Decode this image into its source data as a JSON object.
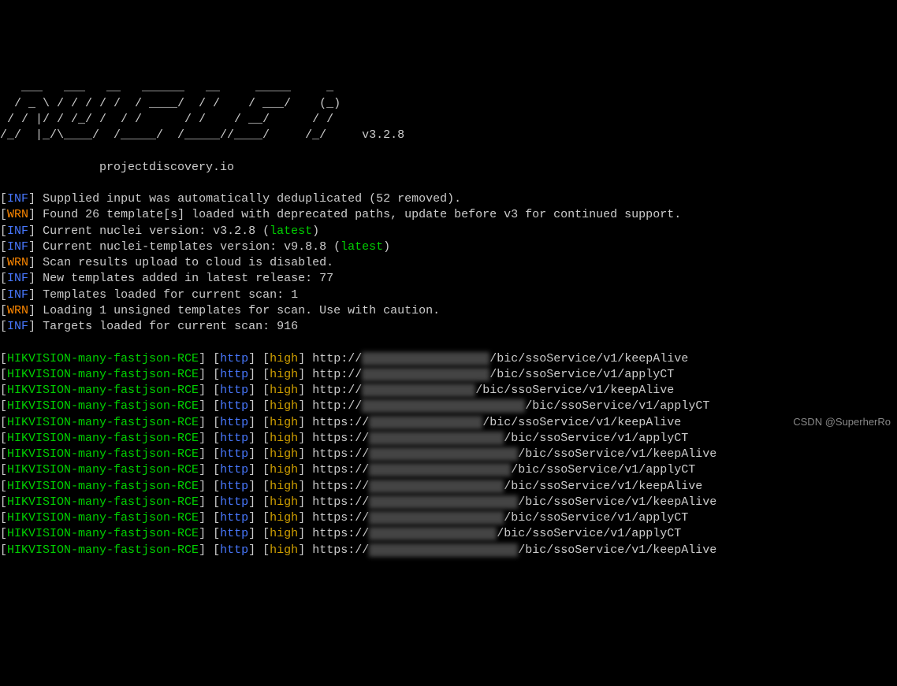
{
  "ascii_art": "         ___                __    _  \n   ____ /  /__ ___ __ _____/ /   (_)\n  / __ \\/ / / / ___/ / /_  / /  / / \n / / / / /_/ / /__/ /  __/ / /__/ /  \n/_/ /_/\\__,_/\\___/_/\\___/_/\\___/_/",
  "version": "v3.2.8",
  "subtitle": "projectdiscovery.io",
  "log_lines": [
    {
      "tag": "INF",
      "text": "Supplied input was automatically deduplicated (52 removed)."
    },
    {
      "tag": "WRN",
      "text": "Found 26 template[s] loaded with deprecated paths, update before v3 for continued support."
    },
    {
      "tag": "INF",
      "text": "Current nuclei version: v3.2.8 (",
      "suffix_green": "latest",
      "suffix_end": ")"
    },
    {
      "tag": "INF",
      "text": "Current nuclei-templates version: v9.8.8 (",
      "suffix_green": "latest",
      "suffix_end": ")"
    },
    {
      "tag": "WRN",
      "text": "Scan results upload to cloud is disabled."
    },
    {
      "tag": "INF",
      "text": "New templates added in latest release: 77"
    },
    {
      "tag": "INF",
      "text": "Templates loaded for current scan: 1"
    },
    {
      "tag": "WRN",
      "text": "Loading 1 unsigned templates for scan. Use with caution."
    },
    {
      "tag": "INF",
      "text": "Targets loaded for current scan: 916"
    }
  ],
  "results": [
    {
      "template": "HIKVISION-many-fastjson-RCE",
      "proto": "http",
      "severity": "high",
      "url_prefix": "http://",
      "url_redacted": "2xx.xxx.xxx.xxx:85",
      "url_suffix": "/bic/ssoService/v1/keepAlive"
    },
    {
      "template": "HIKVISION-many-fastjson-RCE",
      "proto": "http",
      "severity": "high",
      "url_prefix": "http://",
      "url_redacted": "1xx.xxx.xxx.xxx.xx",
      "url_suffix": "/bic/ssoService/v1/applyCT"
    },
    {
      "template": "HIKVISION-many-fastjson-RCE",
      "proto": "http",
      "severity": "high",
      "url_prefix": "http://",
      "url_redacted": "2xx.xxx.xx.xxxxx",
      "url_suffix": "/bic/ssoService/v1/keepAlive"
    },
    {
      "template": "HIKVISION-many-fastjson-RCE",
      "proto": "http",
      "severity": "high",
      "url_prefix": "http://",
      "url_redacted": "xxxxxxxxxxxxxxxxxxxxxxx",
      "url_suffix": "/bic/ssoService/v1/applyCT"
    },
    {
      "template": "HIKVISION-many-fastjson-RCE",
      "proto": "http",
      "severity": "high",
      "url_prefix": "https://",
      "url_redacted": "1xxxxxxxxxxxxxxx",
      "url_suffix": "/bic/ssoService/v1/keepAlive"
    },
    {
      "template": "HIKVISION-many-fastjson-RCE",
      "proto": "http",
      "severity": "high",
      "url_prefix": "https://",
      "url_redacted": "1xxxxxxxxxxxxxxxxxx",
      "url_suffix": "/bic/ssoService/v1/applyCT"
    },
    {
      "template": "HIKVISION-many-fastjson-RCE",
      "proto": "http",
      "severity": "high",
      "url_prefix": "https://",
      "url_redacted": "1xxxxxxxxxxxxxxxxxxxx",
      "url_suffix": "/bic/ssoService/v1/keepAlive"
    },
    {
      "template": "HIKVISION-many-fastjson-RCE",
      "proto": "http",
      "severity": "high",
      "url_prefix": "https://",
      "url_redacted": "1xx.xxx.xxx.xxx:xxxx",
      "url_suffix": "/bic/ssoService/v1/applyCT"
    },
    {
      "template": "HIKVISION-many-fastjson-RCE",
      "proto": "http",
      "severity": "high",
      "url_prefix": "https://",
      "url_redacted": "1xxxxxxxxxxxxxxxxxx",
      "url_suffix": "/bic/ssoService/v1/keepAlive"
    },
    {
      "template": "HIKVISION-many-fastjson-RCE",
      "proto": "http",
      "severity": "high",
      "url_prefix": "https://",
      "url_redacted": "xxxxxxxxxxxxxxxxxxxxx",
      "url_suffix": "/bic/ssoService/v1/keepAlive"
    },
    {
      "template": "HIKVISION-many-fastjson-RCE",
      "proto": "http",
      "severity": "high",
      "url_prefix": "https://",
      "url_redacted": "xxxxxxxxxxxxxxxxxxx",
      "url_suffix": "/bic/ssoService/v1/applyCT"
    },
    {
      "template": "HIKVISION-many-fastjson-RCE",
      "proto": "http",
      "severity": "high",
      "url_prefix": "https://",
      "url_redacted": "1xx.xxx.xxxxxxxxxx",
      "url_suffix": "/bic/ssoService/v1/applyCT"
    },
    {
      "template": "HIKVISION-many-fastjson-RCE",
      "proto": "http",
      "severity": "high",
      "url_prefix": "https://",
      "url_redacted": "1xxxxxxxxxxxxxxxxxxxx",
      "url_suffix": "/bic/ssoService/v1/keepAlive"
    }
  ],
  "watermark": "CSDN @SuperherRo"
}
